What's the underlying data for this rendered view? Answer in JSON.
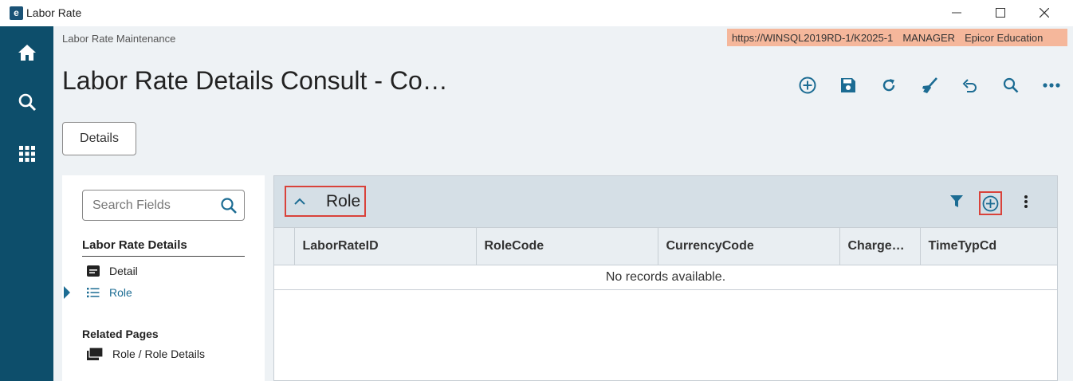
{
  "window": {
    "title": "Labor Rate",
    "logo_letter": "e"
  },
  "header": {
    "breadcrumb": "Labor Rate Maintenance",
    "connection": {
      "url": "https://WINSQL2019RD-1/K2025-1",
      "user": "MANAGER",
      "company": "Epicor Education"
    },
    "page_title": "Labor Rate Details Consult - Co…"
  },
  "toolbar": {
    "icons": [
      "add-new-icon",
      "save-icon",
      "refresh-icon",
      "clear-icon",
      "undo-icon",
      "search-icon",
      "more-options-icon"
    ]
  },
  "details_button": "Details",
  "nav": {
    "search_placeholder": "Search Fields",
    "section_title": "Labor Rate Details",
    "items": [
      {
        "label": "Detail",
        "icon": "card-icon"
      },
      {
        "label": "Role",
        "icon": "list-icon",
        "active": true
      }
    ],
    "related_title": "Related Pages",
    "related": [
      {
        "label": "Role / Role Details",
        "icon": "pages-icon"
      }
    ]
  },
  "grid": {
    "title": "Role",
    "columns": [
      "LaborRateID",
      "RoleCode",
      "CurrencyCode",
      "Charge…",
      "TimeTypCd"
    ],
    "empty_text": "No records available."
  },
  "colors": {
    "rail": "#0d4e6b",
    "accent": "#1c6c93",
    "connection_bar": "#f5b79b",
    "highlight": "#d9423a"
  }
}
